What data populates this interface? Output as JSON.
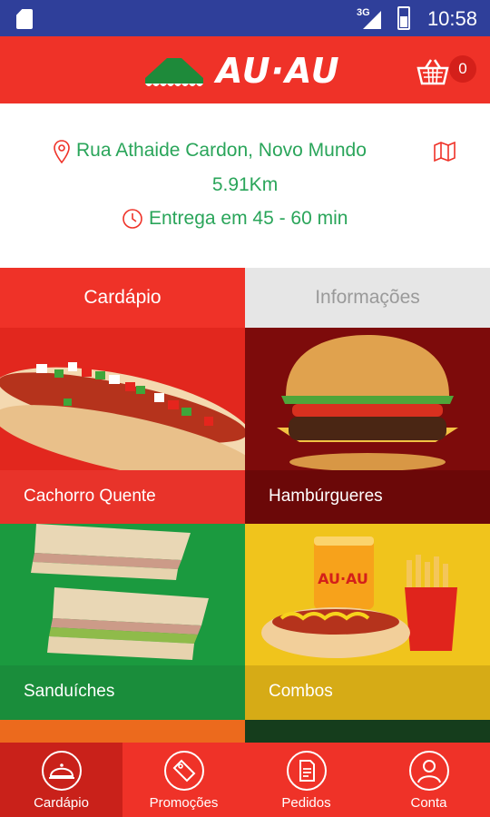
{
  "status_bar": {
    "network": "3G",
    "time": "10:58"
  },
  "header": {
    "brand": "AU·AU",
    "cart_count": "0"
  },
  "store": {
    "address": "Rua Athaide Cardon, Novo Mundo",
    "distance": "5.91Km",
    "delivery": "Entrega em 45 - 60 min"
  },
  "tabs": [
    {
      "label": "Cardápio",
      "active": true
    },
    {
      "label": "Informações",
      "active": false
    }
  ],
  "categories": [
    {
      "label": "Cachorro Quente"
    },
    {
      "label": "Hambúrgueres"
    },
    {
      "label": "Sanduíches"
    },
    {
      "label": "Combos"
    }
  ],
  "combo_art_text": "AU·AU",
  "bottom_nav": [
    {
      "label": "Cardápio",
      "icon": "cloche-icon",
      "active": true
    },
    {
      "label": "Promoções",
      "icon": "tag-icon",
      "active": false
    },
    {
      "label": "Pedidos",
      "icon": "document-icon",
      "active": false
    },
    {
      "label": "Conta",
      "icon": "user-icon",
      "active": false
    }
  ],
  "colors": {
    "primary_red": "#ef3228",
    "status_bar": "#2f3f9a",
    "accent_green": "#2aa55a",
    "tab_inactive_bg": "#e6e6e6"
  }
}
